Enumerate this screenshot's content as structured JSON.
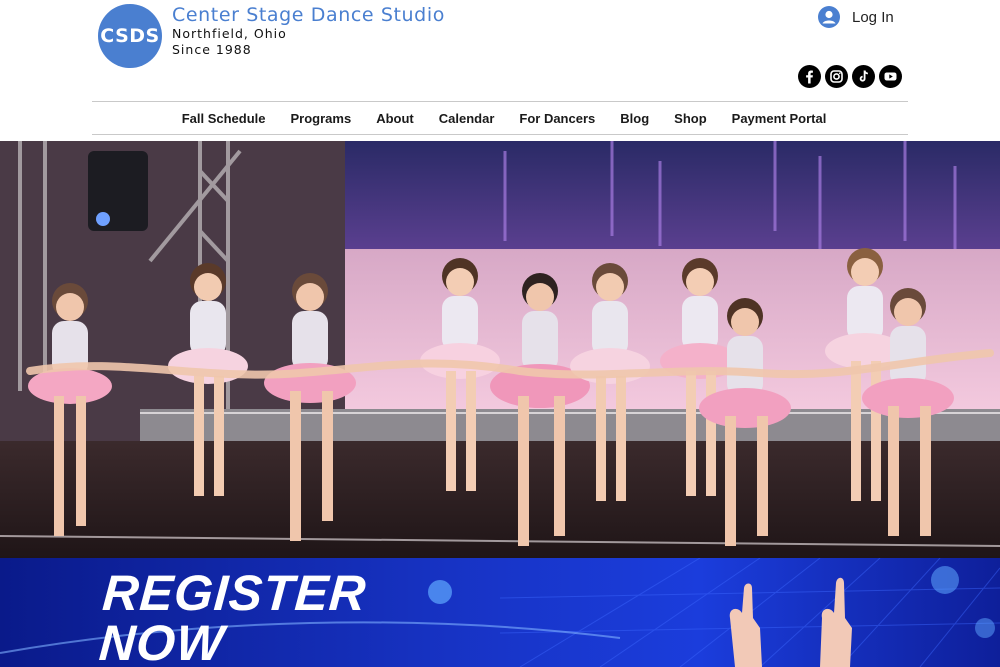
{
  "site": {
    "logo_text": "CSDS",
    "title": "Center Stage Dance Studio",
    "location": "Northfield, Ohio",
    "since": "Since 1988"
  },
  "account": {
    "login_label": "Log In",
    "avatar_icon": "user-avatar-icon"
  },
  "socials": [
    {
      "name": "facebook-icon"
    },
    {
      "name": "instagram-icon"
    },
    {
      "name": "tiktok-icon"
    },
    {
      "name": "youtube-icon"
    }
  ],
  "nav": {
    "items": [
      {
        "label": "Fall Schedule"
      },
      {
        "label": "Programs"
      },
      {
        "label": "About"
      },
      {
        "label": "Calendar"
      },
      {
        "label": "For Dancers"
      },
      {
        "label": "Blog"
      },
      {
        "label": "Shop"
      },
      {
        "label": "Payment Portal"
      }
    ]
  },
  "banner": {
    "line1": "REGISTER",
    "line2": "NOW"
  },
  "colors": {
    "brand_blue": "#4a7fd0",
    "banner_blue": "#1733c4",
    "nav_divider": "#c9c9c9"
  }
}
